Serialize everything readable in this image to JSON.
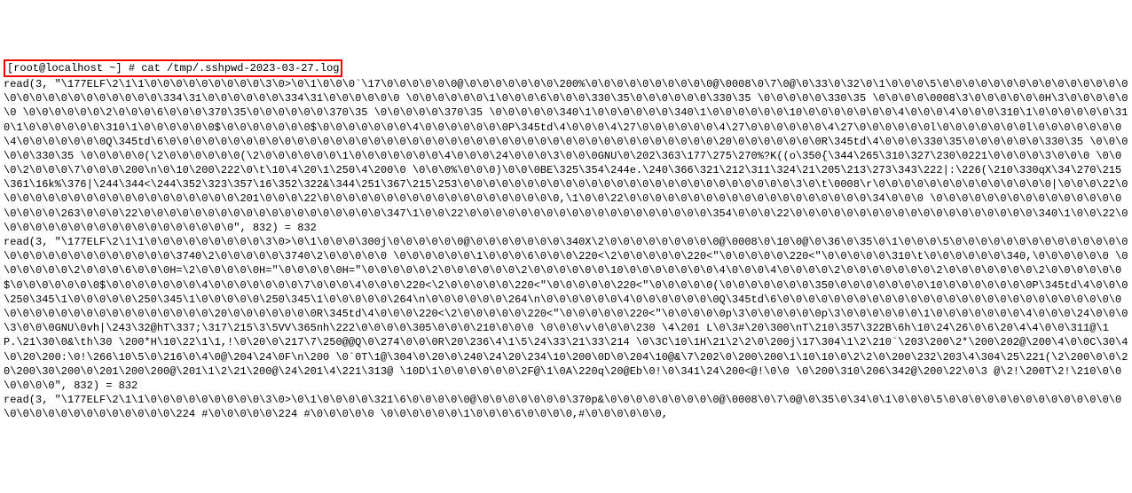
{
  "terminal": {
    "prompt_prefix": "[root@localhost ~]",
    "prompt_symbol": "#",
    "command": "cat /tmp/.sshpwd-2023-03-27.log",
    "output": "read(3, \"\\177ELF\\2\\1\\1\\0\\0\\0\\0\\0\\0\\0\\0\\0\\3\\0>\\0\\1\\0\\0\\0`\\17\\0\\0\\0\\0\\0\\0@\\0\\0\\0\\0\\0\\0\\0\\200%\\0\\0\\0\\0\\0\\0\\0\\0\\0\\0@\\0008\\0\\7\\0@\\0\\33\\0\\32\\0\\1\\0\\0\\0\\5\\0\\0\\0\\0\\0\\0\\0\\0\\0\\0\\0\\0\\0\\0\\0\\0\\0\\0\\0\\0\\0\\0\\0\\0\\0\\0\\0\\334\\31\\0\\0\\0\\0\\0\\0\\334\\31\\0\\0\\0\\0\\0\\0 \\0\\0\\0\\0\\0\\0\\1\\0\\0\\0\\6\\0\\0\\0\\330\\35\\0\\0\\0\\0\\0\\0\\330\\35 \\0\\0\\0\\0\\0\\330\\35 \\0\\0\\0\\0\\0008\\3\\0\\0\\0\\0\\0\\0H\\3\\0\\0\\0\\0\\0\\0 \\0\\0\\0\\0\\0\\0\\2\\0\\0\\0\\6\\0\\0\\0\\370\\35\\0\\0\\0\\0\\0\\0\\370\\35 \\0\\0\\0\\0\\0\\370\\35 \\0\\0\\0\\0\\0\\340\\1\\0\\0\\0\\0\\0\\0\\340\\1\\0\\0\\0\\0\\0\\0\\10\\0\\0\\0\\0\\0\\0\\0\\4\\0\\0\\0\\4\\0\\0\\0\\310\\1\\0\\0\\0\\0\\0\\0\\310\\1\\0\\0\\0\\0\\0\\0\\310\\1\\0\\0\\0\\0\\0\\0$\\0\\0\\0\\0\\0\\0\\0$\\0\\0\\0\\0\\0\\0\\0\\4\\0\\0\\0\\0\\0\\0\\0P\\345td\\4\\0\\0\\0\\4\\27\\0\\0\\0\\0\\0\\0\\4\\27\\0\\0\\0\\0\\0\\0\\4\\27\\0\\0\\0\\0\\0\\0l\\0\\0\\0\\0\\0\\0\\0l\\0\\0\\0\\0\\0\\0\\0\\4\\0\\0\\0\\0\\0\\0\\0Q\\345td\\6\\0\\0\\0\\0\\0\\0\\0\\0\\0\\0\\0\\0\\0\\0\\0\\0\\0\\0\\0\\0\\0\\0\\0\\0\\0\\0\\0\\0\\0\\0\\0\\0\\0\\0\\0\\0\\0\\0\\0\\0\\0\\0\\0\\20\\0\\0\\0\\0\\0\\0\\0R\\345td\\4\\0\\0\\0\\330\\35\\0\\0\\0\\0\\0\\0\\330\\35 \\0\\0\\0\\0\\0\\330\\35 \\0\\0\\0\\0\\0(\\2\\0\\0\\0\\0\\0\\0(\\2\\0\\0\\0\\0\\0\\0\\1\\0\\0\\0\\0\\0\\0\\0\\4\\0\\0\\0\\24\\0\\0\\0\\3\\0\\0\\0GNU\\0\\202\\363\\177\\275\\270%?K((o\\350{\\344\\265\\310\\327\\230\\0221\\0\\0\\0\\0\\3\\0\\0\\0 \\0\\0\\0\\2\\0\\0\\0\\7\\0\\0\\0\\200\\n\\0\\10\\200\\222\\0\\t\\10\\4\\20\\1\\250\\4\\200\\0 \\0\\0\\0%\\0\\0\\0)\\0\\0\\0BE\\325\\354\\244e.\\240\\366\\321\\212\\311\\324\\21\\205\\213\\273\\343\\222|:\\226(\\210\\330qX\\34\\270\\215\\361\\16k%\\376|\\244\\344<\\244\\352\\323\\357\\16\\352\\322&\\344\\251\\367\\215\\253\\0\\0\\0\\0\\0\\0\\0\\0\\0\\0\\0\\0\\0\\0\\0\\0\\0\\0\\0\\0\\0\\0\\0\\0\\0\\0\\3\\0\\t\\0008\\r\\0\\0\\0\\0\\0\\0\\0\\0\\0\\0\\0\\0\\0\\0|\\0\\0\\0\\22\\0\\0\\0\\0\\0\\0\\0\\0\\0\\0\\0\\0\\0\\0\\0\\0\\0\\0\\0\\201\\0\\0\\0\\22\\0\\0\\0\\0\\0\\0\\0\\0\\0\\0\\0\\0\\0\\0\\0\\0\\0\\0\\0,\\1\\0\\0\\22\\0\\0\\0\\0\\0\\0\\0\\0\\0\\0\\0\\0\\0\\0\\0\\0\\0\\0\\0\\34\\0\\0\\0 \\0\\0\\0\\0\\0\\0\\0\\0\\0\\0\\0\\0\\0\\0\\0\\0\\0\\0\\0\\263\\0\\0\\0\\22\\0\\0\\0\\0\\0\\0\\0\\0\\0\\0\\0\\0\\0\\0\\0\\0\\0\\0\\0\\347\\1\\0\\0\\22\\0\\0\\0\\0\\0\\0\\0\\0\\0\\0\\0\\0\\0\\0\\0\\0\\0\\0\\0\\354\\0\\0\\0\\22\\0\\0\\0\\0\\0\\0\\0\\0\\0\\0\\0\\0\\0\\0\\0\\0\\0\\0\\0\\340\\1\\0\\0\\22\\0\\0\\0\\0\\0\\0\\0\\0\\0\\0\\0\\0\\0\\0\\0\\0\\0\\0\\0\", 832) = 832\nread(3, \"\\177ELF\\2\\1\\1\\0\\0\\0\\0\\0\\0\\0\\0\\0\\3\\0>\\0\\1\\0\\0\\0\\300j\\0\\0\\0\\0\\0\\0@\\0\\0\\0\\0\\0\\0\\0\\340X\\2\\0\\0\\0\\0\\0\\0\\0\\0\\0@\\0008\\0\\10\\0@\\0\\36\\0\\35\\0\\1\\0\\0\\0\\5\\0\\0\\0\\0\\0\\0\\0\\0\\0\\0\\0\\0\\0\\0\\0\\0\\0\\0\\0\\0\\0\\0\\0\\0\\0\\0\\0\\3740\\2\\0\\0\\0\\0\\0\\3740\\2\\0\\0\\0\\0\\0 \\0\\0\\0\\0\\0\\0\\1\\0\\0\\0\\6\\0\\0\\0\\220<\\2\\0\\0\\0\\0\\0\\220<\"\\0\\0\\0\\0\\0\\220<\"\\0\\0\\0\\0\\0\\310\\t\\0\\0\\0\\0\\0\\0\\340,\\0\\0\\0\\0\\0\\0 \\0\\0\\0\\0\\0\\0\\2\\0\\0\\0\\6\\0\\0\\0H=\\2\\0\\0\\0\\0\\0H=\"\\0\\0\\0\\0\\0H=\"\\0\\0\\0\\0\\0\\2\\0\\0\\0\\0\\0\\0\\2\\0\\0\\0\\0\\0\\0\\10\\0\\0\\0\\0\\0\\0\\0\\4\\0\\0\\0\\4\\0\\0\\0\\0\\2\\0\\0\\0\\0\\0\\0\\0\\2\\0\\0\\0\\0\\0\\0\\0\\2\\0\\0\\0\\0\\0\\0$\\0\\0\\0\\0\\0\\0\\0$\\0\\0\\0\\0\\0\\0\\0\\4\\0\\0\\0\\0\\0\\0\\0\\7\\0\\0\\0\\4\\0\\0\\0\\220<\\2\\0\\0\\0\\0\\0\\220<\"\\0\\0\\0\\0\\0\\220<\"\\0\\0\\0\\0\\0(\\0\\0\\0\\0\\0\\0\\0\\350\\0\\0\\0\\0\\0\\0\\0\\10\\0\\0\\0\\0\\0\\0\\0P\\345td\\4\\0\\0\\0\\250\\345\\1\\0\\0\\0\\0\\0\\250\\345\\1\\0\\0\\0\\0\\0\\250\\345\\1\\0\\0\\0\\0\\0\\264\\n\\0\\0\\0\\0\\0\\0\\264\\n\\0\\0\\0\\0\\0\\0\\4\\0\\0\\0\\0\\0\\0\\0Q\\345td\\6\\0\\0\\0\\0\\0\\0\\0\\0\\0\\0\\0\\0\\0\\0\\0\\0\\0\\0\\0\\0\\0\\0\\0\\0\\0\\0\\0\\0\\0\\0\\0\\0\\0\\0\\0\\0\\0\\0\\0\\0\\0\\0\\0\\20\\0\\0\\0\\0\\0\\0\\0R\\345td\\4\\0\\0\\0\\220<\\2\\0\\0\\0\\0\\0\\220<\"\\0\\0\\0\\0\\0\\220<\"\\0\\0\\0\\0\\0p\\3\\0\\0\\0\\0\\0\\0p\\3\\0\\0\\0\\0\\0\\0\\1\\0\\0\\0\\0\\0\\0\\0\\4\\0\\0\\0\\24\\0\\0\\0\\3\\0\\0\\0GNU\\0vh|\\243\\32@hT\\337;\\317\\215\\3\\5VV\\365nh\\222\\0\\0\\0\\0\\305\\0\\0\\0\\210\\0\\0\\0 \\0\\0\\0\\v\\0\\0\\0\\230 \\4\\201 L\\0\\3#\\20\\300\\nT\\210\\357\\322B\\6h\\10\\24\\26\\0\\6\\20\\4\\4\\0\\0\\311@\\1P.\\21\\30\\0&\\th\\30 \\200*H\\10\\22\\1\\1,!\\0\\20\\0\\217\\7\\250@@Q\\0\\274\\0\\0\\0R\\20\\236\\4\\1\\5\\24\\33\\21\\33\\214 \\0\\3C\\10\\1H\\21\\2\\2\\0\\200j\\17\\304\\1\\2\\210`\\203\\200\\2*\\200\\202@\\200\\4\\0\\0C\\30\\4\\0\\20\\200:\\0!\\266\\10\\5\\0\\216\\0\\4\\0@\\204\\24\\0F\\n\\200 \\0`0T\\1@\\304\\0\\20\\0\\240\\24\\20\\234\\10\\200\\0D\\0\\204\\10@&\\7\\202\\0\\200\\200\\1\\10\\10\\0\\2\\2\\0\\200\\232\\203\\4\\304\\25\\221(\\2\\200\\0\\0\\20\\200\\30\\200\\0\\201\\200\\200@\\201\\1\\2\\21\\200@\\24\\201\\4\\221\\313@ \\10D\\1\\0\\0\\0\\0\\0\\0\\2F@\\1\\0A\\220q\\20@Eb\\0!\\0\\341\\24\\200<@!\\0\\0 \\0\\200\\310\\206\\342@\\200\\22\\0\\3 @\\2!\\200T\\2!\\210\\0\\0\\0\\0\\0\\0\", 832) = 832\nread(3, \"\\177ELF\\2\\1\\1\\0\\0\\0\\0\\0\\0\\0\\0\\0\\3\\0>\\0\\1\\0\\0\\0\\0\\321\\6\\0\\0\\0\\0\\0@\\0\\0\\0\\0\\0\\0\\0\\370p&\\0\\0\\0\\0\\0\\0\\0\\0\\0@\\0008\\0\\7\\0@\\0\\35\\0\\34\\0\\1\\0\\0\\0\\5\\0\\0\\0\\0\\0\\0\\0\\0\\0\\0\\0\\0\\0\\0\\0\\0\\0\\0\\0\\0\\0\\0\\0\\0\\0\\0\\0\\224 #\\0\\0\\0\\0\\0\\224 #\\0\\0\\0\\0\\0 \\0\\0\\0\\0\\0\\0\\1\\0\\0\\0\\6\\0\\0\\0\\0,#\\0\\0\\0\\0\\0\\0,"
  }
}
